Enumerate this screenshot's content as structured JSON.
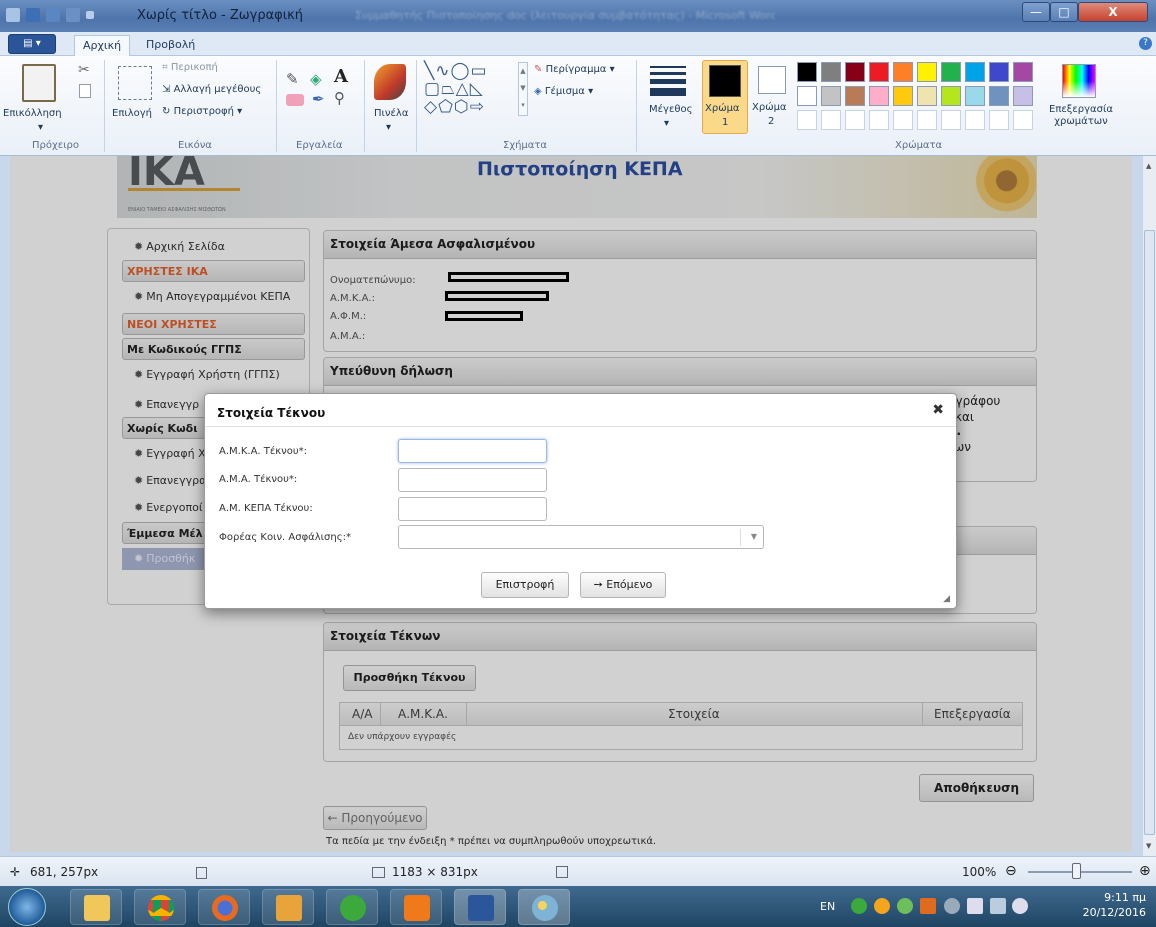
{
  "window": {
    "title": "Χωρίς τίτλο - Ζωγραφική",
    "faint_title": "Συμμαθητής Πιστοποίησης doc (λειτουργία συμβατότητας) - Microsoft Word",
    "min_label": "—",
    "max_label": "□",
    "close_label": "X"
  },
  "ribbon": {
    "tabs": [
      {
        "label": "Αρχική"
      },
      {
        "label": "Προβολή"
      }
    ],
    "file_label": "▤ ▾",
    "help_label": "?",
    "groups": {
      "clipboard": {
        "label": "Πρόχειρο",
        "paste": "Επικόλληση"
      },
      "image": {
        "label": "Εικόνα",
        "select": "Επιλογή",
        "crop": "Περικοπή",
        "resize": "Αλλαγή μεγέθους",
        "rotate": "Περιστροφή"
      },
      "tools": {
        "label": "Εργαλεία"
      },
      "brushes": {
        "label": "Πινέλα"
      },
      "shapes": {
        "label": "Σχήματα",
        "outline": "Περίγραμμα",
        "fill": "Γέμισμα"
      },
      "size": {
        "label": "Μέγεθος"
      },
      "color1": {
        "label": "Χρώμα",
        "num": "1"
      },
      "color2": {
        "label": "Χρώμα",
        "num": "2"
      },
      "colors": {
        "label": "Χρώματα"
      },
      "edit_colors": {
        "label": "Επεξεργασία χρωμάτων"
      }
    },
    "palette_colors": [
      "#000000",
      "#7f7f7f",
      "#880015",
      "#ed1c24",
      "#ff7f27",
      "#fff200",
      "#22b14c",
      "#00a2e8",
      "#3f48cc",
      "#a349a4",
      "#ffffff",
      "#c3c3c3",
      "#b97a57",
      "#ffaec9",
      "#ffc90e",
      "#efe4b0",
      "#b5e61d",
      "#99d9ea",
      "#7092be",
      "#c8bfe7"
    ]
  },
  "page": {
    "logo": "IKA",
    "logo_sub": "ΕΝΙΑΙΟ ΤΑΜΕΙΟ ΑΣΦΑΛΙΣΗΣ ΜΙΣΘΩΤΩΝ",
    "title": "Πιστοποίηση ΚΕΠΑ",
    "sidebar": {
      "home": "Αρχική Σελίδα",
      "ika_users": "ΧΡΗΣΤΕΣ ΙΚΑ",
      "unregistered": "Μη Απογεγραμμένοι ΚΕΠΑ",
      "new_users": "ΝΕΟΙ ΧΡΗΣΤΕΣ",
      "with_codes": "Με Κωδικούς ΓΓΠΣ",
      "register_ggps": "Εγγραφή Χρήστη (ΓΓΠΣ)",
      "reregister": "Επανεγγρ",
      "without_codes": "Χωρίς Κωδι",
      "register2": "Εγγραφή Χ",
      "reregister2": "Επανεγγρα",
      "activation": "Ενεργοποί",
      "indirect": "Έμμεσα Μέλ",
      "add": "Προσθήκ"
    },
    "insured": {
      "header": "Στοιχεία Άμεσα Ασφαλισμένου",
      "name_label": "Ονοματεπώνυμο:",
      "amka_label": "Α.Μ.Κ.Α.:",
      "afm_label": "Α.Φ.Μ.:",
      "ama_label": "Α.Μ.Α.:"
    },
    "declaration": {
      "header": "Υπεύθυνη δήλωση",
      "text_1": "ραγράφου",
      "text_2": "ις και",
      "text_3": "Μ..",
      "text_4": "λλων"
    },
    "children": {
      "header": "Στοιχεία Τέκνων",
      "add_button": "Προσθήκη Τέκνου",
      "columns": [
        "Α/Α",
        "Α.Μ.Κ.Α.",
        "Στοιχεία",
        "Επεξεργασία"
      ],
      "empty": "Δεν υπάρχουν εγγραφές"
    },
    "save_button": "Αποθήκευση",
    "prev_button": "← Προηγούμενο",
    "footnote": "Τα πεδία με την ένδειξη * πρέπει να συμπληρωθούν υποχρεωτικά."
  },
  "modal": {
    "title": "Στοιχεία Τέκνου",
    "close": "✖",
    "fields": {
      "amka_label": "Α.Μ.Κ.Α. Τέκνου*:",
      "ama_label": "Α.Μ.Α. Τέκνου*:",
      "am_kepa_label": "Α.Μ. ΚΕΠΑ Τέκνου:",
      "insurer_label": "Φορέας Κοιν. Ασφάλισης:*"
    },
    "back_button": "Επιστροφή",
    "next_button": "➙ Επόμενο"
  },
  "statusbar": {
    "cursor": "681, 257px",
    "size": "1183 × 831px",
    "zoom": "100%"
  },
  "taskbar": {
    "lang": "EN",
    "time": "9:11 πμ",
    "date": "20/12/2016"
  }
}
